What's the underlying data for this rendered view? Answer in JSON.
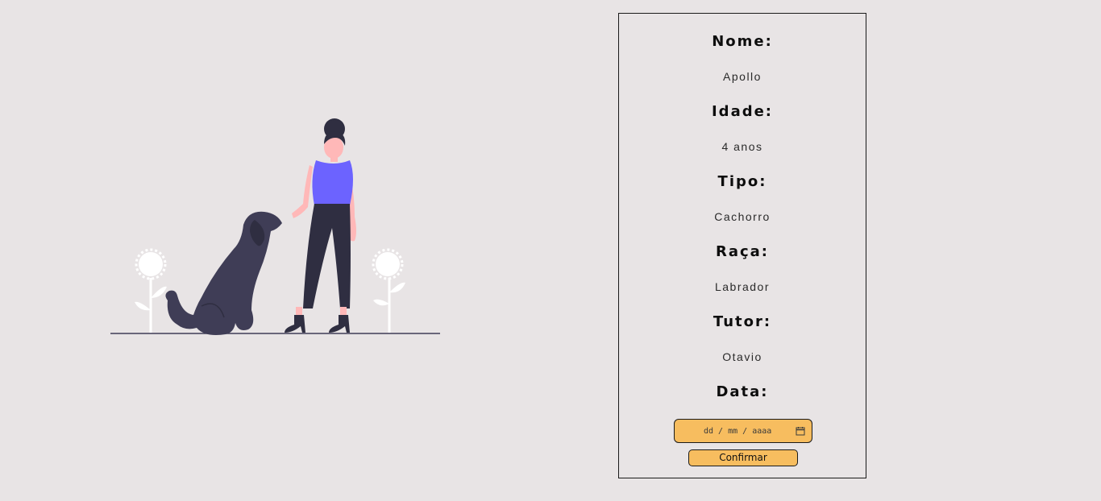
{
  "pet_card": {
    "name_label": "Nome:",
    "name_value": "Apollo",
    "age_label": "Idade:",
    "age_value": "4 anos",
    "type_label": "Tipo:",
    "type_value": "Cachorro",
    "breed_label": "Raça:",
    "breed_value": "Labrador",
    "tutor_label": "Tutor:",
    "tutor_value": "Otavio",
    "date_label": "Data:",
    "date_placeholder": "dd / mm / aaaa",
    "date_icon": "calendar-icon",
    "confirm_label": "Confirmar"
  },
  "colors": {
    "background": "#e8e4e5",
    "accent": "#f7bd5f",
    "illustration_purple": "#6c63ff",
    "illustration_dark": "#3f3d56"
  }
}
